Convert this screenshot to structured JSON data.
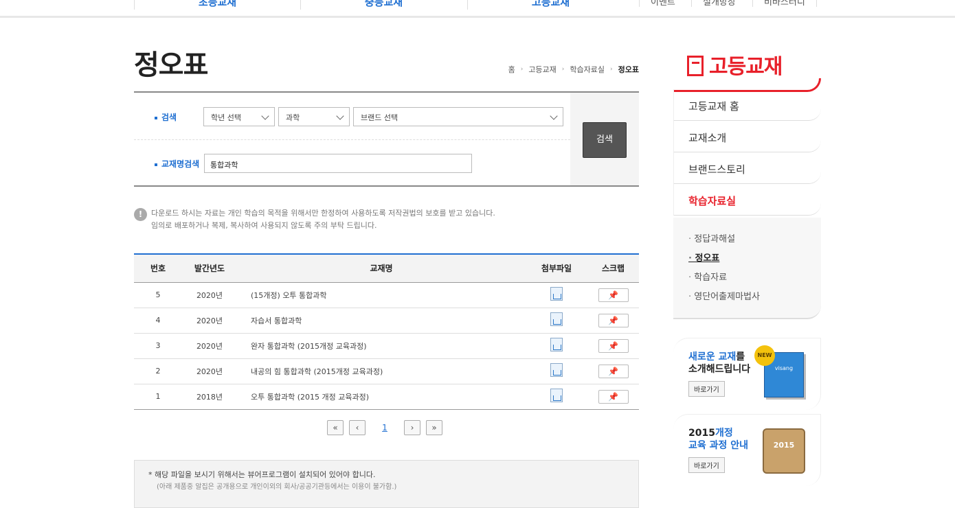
{
  "topnav": {
    "items": [
      "초등교재",
      "중등교재",
      "고등교재"
    ],
    "links": [
      "이벤트",
      "설개방장",
      "비바스터디"
    ]
  },
  "page": {
    "title": "정오표",
    "breadcrumb": [
      "홈",
      "고등교재",
      "학습자료실",
      "정오표"
    ]
  },
  "search": {
    "label_search": "검색",
    "label_bookname": "교재명검색",
    "grade_select": "학년 선택",
    "subject_select": "과학",
    "brand_select": "브랜드 선택",
    "bookname_value": "통합과학",
    "button": "검색"
  },
  "notice": {
    "line1": "다운로드 하시는 자료는 개인 학습의 목적을 위해서만 한정하여 사용하도록 저작권법의 보호를 받고 있습니다.",
    "line2": "임의로 배포하거나 복제, 복사하여 사용되지 않도록 주의 부탁 드립니다."
  },
  "table": {
    "headers": [
      "번호",
      "발간년도",
      "교재명",
      "첨부파일",
      "스크랩"
    ],
    "rows": [
      {
        "no": "5",
        "year": "2020년",
        "name": "(15개정) 오투 통합과학"
      },
      {
        "no": "4",
        "year": "2020년",
        "name": "자습서 통합과학"
      },
      {
        "no": "3",
        "year": "2020년",
        "name": "완자 통합과학 (2015개정 교육과정)"
      },
      {
        "no": "2",
        "year": "2020년",
        "name": "내공의 힘 통합과학 (2015개정 교육과정)"
      },
      {
        "no": "1",
        "year": "2018년",
        "name": "오투 통합과학 (2015 개정 교육과정)"
      }
    ]
  },
  "pager": {
    "current": "1"
  },
  "footer": {
    "line1": "* 해당 파일을 보시기 위해서는 뷰어프로그램이 설치되어 있어야 합니다.",
    "line2": "(아래 제품중 알집은 공개용으로 개인이외의 회사/공공기관등에서는 이용이 불가함.)"
  },
  "sidebar": {
    "brand": "고등교재",
    "menu": [
      "고등교재 홈",
      "교재소개",
      "브랜드스토리",
      "학습자료실"
    ],
    "submenu": [
      "정답과해설",
      "정오표",
      "학습자료",
      "영단어출제마법사"
    ],
    "banner1": {
      "blue": "새로운 교재",
      "rest": "를",
      "line2": "소개해드립니다",
      "go": "바로가기",
      "badge": "NEW",
      "book_text": "visang"
    },
    "banner2": {
      "line1a": "2015",
      "line1b": "개정",
      "line2": "교육 과정 안내",
      "go": "바로가기",
      "note_text": "2015"
    }
  }
}
